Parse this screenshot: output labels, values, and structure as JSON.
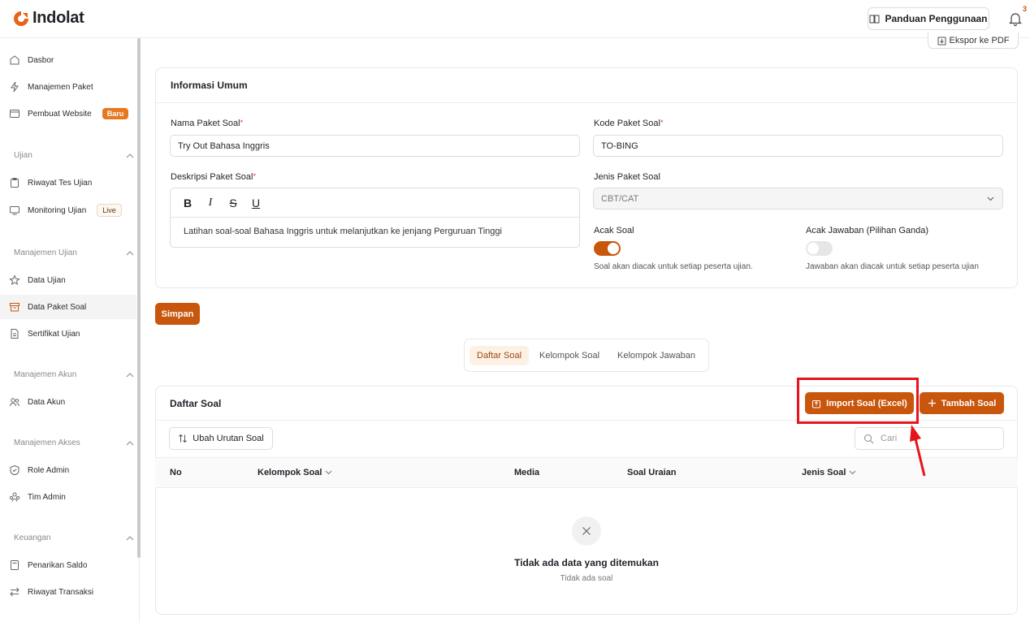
{
  "header": {
    "logo_text": "Indolat",
    "guide_label": "Panduan Penggunaan",
    "notification_count": "3"
  },
  "sidebar": {
    "items_top": [
      {
        "label": "Dasbor",
        "icon": "home-icon"
      },
      {
        "label": "Manajemen Paket",
        "icon": "bolt-icon"
      },
      {
        "label": "Pembuat Website",
        "icon": "window-icon",
        "badge": "Baru"
      }
    ],
    "sections": [
      {
        "title": "Ujian",
        "items": [
          {
            "label": "Riwayat Tes Ujian",
            "icon": "clipboard-icon"
          },
          {
            "label": "Monitoring Ujian",
            "icon": "monitor-icon",
            "badge": "Live"
          }
        ]
      },
      {
        "title": "Manajemen Ujian",
        "items": [
          {
            "label": "Data Ujian",
            "icon": "star-icon"
          },
          {
            "label": "Data Paket Soal",
            "icon": "archive-icon",
            "active": true
          },
          {
            "label": "Sertifikat Ujian",
            "icon": "document-icon"
          }
        ]
      },
      {
        "title": "Manajemen Akun",
        "items": [
          {
            "label": "Data Akun",
            "icon": "users-icon"
          }
        ]
      },
      {
        "title": "Manajemen Akses",
        "items": [
          {
            "label": "Role Admin",
            "icon": "shield-icon"
          },
          {
            "label": "Tim Admin",
            "icon": "team-icon"
          }
        ]
      },
      {
        "title": "Keuangan",
        "items": [
          {
            "label": "Penarikan Saldo",
            "icon": "wallet-icon"
          },
          {
            "label": "Riwayat Transaksi",
            "icon": "transfer-icon"
          }
        ]
      }
    ]
  },
  "export_label": "Ekspor ke PDF",
  "info": {
    "title": "Informasi Umum",
    "name_label": "Nama Paket Soal",
    "name_value": "Try Out Bahasa Inggris",
    "code_label": "Kode Paket Soal",
    "code_value": "TO-BING",
    "desc_label": "Deskripsi Paket Soal",
    "desc_value": "Latihan soal-soal Bahasa Inggris untuk melanjutkan ke jenjang Perguruan Tinggi",
    "type_label": "Jenis Paket Soal",
    "type_value": "CBT/CAT",
    "shuffle_q_label": "Acak Soal",
    "shuffle_q_on": true,
    "shuffle_q_hint": "Soal akan diacak untuk setiap peserta ujian.",
    "shuffle_a_label": "Acak Jawaban (Pilihan Ganda)",
    "shuffle_a_on": false,
    "shuffle_a_hint": "Jawaban akan diacak untuk setiap peserta ujian",
    "required_mark": "*"
  },
  "save_label": "Simpan",
  "tabs": [
    "Daftar Soal",
    "Kelompok Soal",
    "Kelompok Jawaban"
  ],
  "questions": {
    "title": "Daftar Soal",
    "import_label": "Import Soal (Excel)",
    "add_label": "Tambah Soal",
    "reorder_label": "Ubah Urutan Soal",
    "search_placeholder": "Cari",
    "columns": [
      "No",
      "Kelompok Soal",
      "Media",
      "Soal Uraian",
      "Jenis Soal"
    ],
    "empty_title": "Tidak ada data yang ditemukan",
    "empty_sub": "Tidak ada soal"
  },
  "colors": {
    "accent": "#c8560c",
    "annotation": "#e8141b"
  }
}
